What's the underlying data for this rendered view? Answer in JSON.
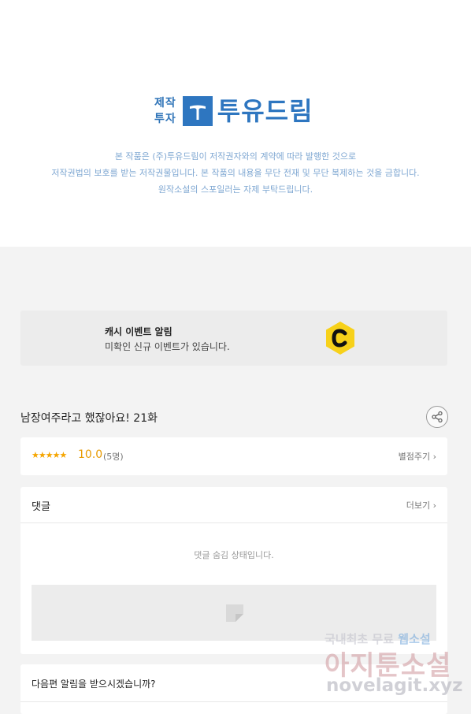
{
  "publisher": {
    "small_line1": "제작",
    "small_line2": "투자",
    "brand_name": "투유드림",
    "notice_lines": [
      "본 작품은 (주)투유드림이 저작권자와의 계약에 따라 발행한 것으로",
      "저작권법의 보호를 받는 저작권물입니다. 본 작품의 내용을 무단 전재 및 무단 복제하는 것을 금합니다.",
      "원작소설의 스포일러는 자제 부탁드립니다."
    ]
  },
  "cash_banner": {
    "title": "캐시 이벤트 알림",
    "subtitle": "미확인 신규 이벤트가 있습니다.",
    "icon": "cash-c-icon"
  },
  "episode": {
    "title": "남장여주라고 했잖아요! 21화",
    "share_icon": "share-icon"
  },
  "rating": {
    "stars": "★★★★★",
    "score": "10.0",
    "count": "(5명)",
    "action_label": "별점주기"
  },
  "comments": {
    "header": "댓글",
    "more_label": "더보기",
    "hidden_message": "댓글 숨김 상태입니다."
  },
  "next_episode": {
    "question": "다음편 알림을 받으시겠습니까?"
  },
  "watermark": {
    "line1_prefix": "국내최초 무료",
    "line1_highlight": "웹소설",
    "line2": "아지툰소설",
    "line3": "novelagit.xyz"
  },
  "colors": {
    "brand_blue": "#2e76c0",
    "cash_yellow": "#f7d11a",
    "star": "#f5a500"
  }
}
